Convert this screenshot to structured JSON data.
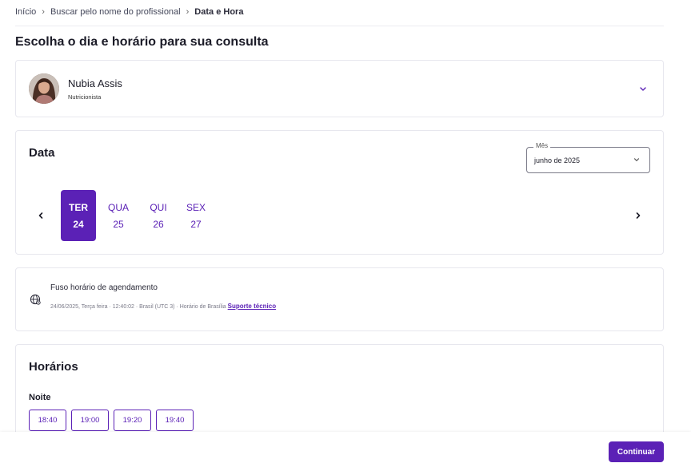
{
  "breadcrumb": {
    "items": [
      "Início",
      "Buscar pelo nome do profissional"
    ],
    "current": "Data e Hora",
    "separator": "›"
  },
  "page": {
    "title": "Escolha o dia e horário para sua consulta"
  },
  "professional": {
    "name": "Nubia Assis",
    "role": "Nutricionista",
    "icon": "chevron-down-icon"
  },
  "date_section": {
    "heading": "Data",
    "month_select": {
      "legend": "Mês",
      "value": "junho de 2025"
    },
    "days": [
      {
        "name": "TER",
        "number": "24",
        "selected": true
      },
      {
        "name": "QUA",
        "number": "25",
        "selected": false
      },
      {
        "name": "QUI",
        "number": "26",
        "selected": false
      },
      {
        "name": "SEX",
        "number": "27",
        "selected": false
      }
    ]
  },
  "timezone": {
    "title": "Fuso horário de agendamento",
    "info": "24/06/2025, Terça feira · 12:40:02 · Brasil (UTC 3) · Horário de Brasília",
    "support_link": "Suporte técnico",
    "icon": "globe-icon"
  },
  "hours": {
    "heading": "Horários",
    "period": "Noite",
    "slots": [
      "18:40",
      "19:00",
      "19:20",
      "19:40"
    ]
  },
  "footer": {
    "continue_label": "Continuar"
  },
  "colors": {
    "accent": "#5b21b6",
    "border": "#e7e7ee"
  }
}
